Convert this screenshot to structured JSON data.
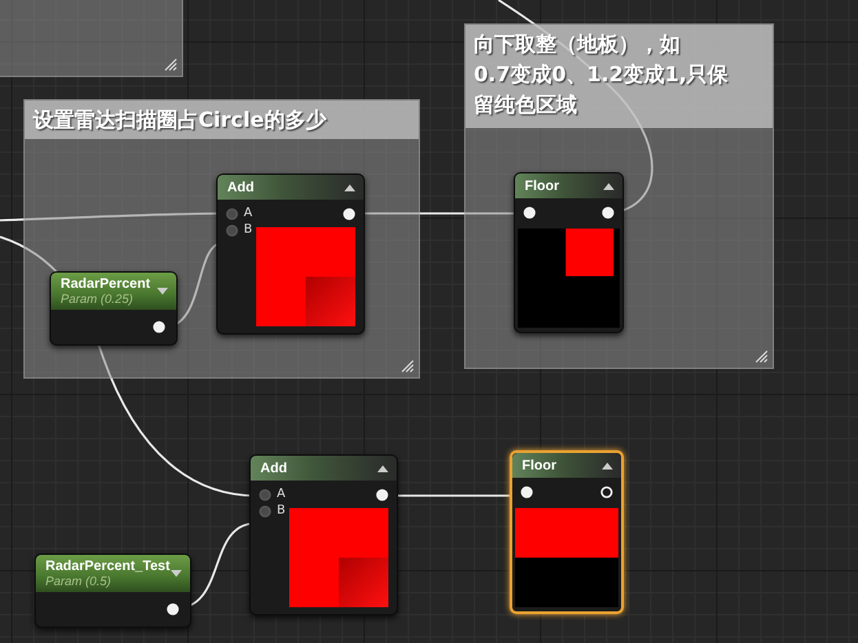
{
  "comments": [
    {
      "kind": "cut-off"
    },
    {
      "kind": "note",
      "text": "设置雷达扫描圈占Circle的多少"
    },
    {
      "kind": "note",
      "lines": [
        "向下取整（地板），如",
        "0.7变成0、1.2变成1,只保",
        "留纯色区域"
      ]
    }
  ],
  "nodes": [
    {
      "kind": "math",
      "title": "Add",
      "selected": false,
      "preview_expanded": true,
      "inputs": [
        {
          "label": "A",
          "connected": true
        },
        {
          "label": "B",
          "connected": true
        }
      ],
      "output": {
        "connected": true
      }
    },
    {
      "kind": "param",
      "title": "RadarPercent",
      "subtitle": "Param (0.25)",
      "selected": false,
      "preview_expanded": false,
      "output": {
        "connected": true
      }
    },
    {
      "kind": "math",
      "title": "Floor",
      "selected": false,
      "preview_expanded": true,
      "inputs": [
        {
          "connected": true
        }
      ],
      "output": {
        "connected": true
      }
    },
    {
      "kind": "math",
      "title": "Add",
      "selected": false,
      "preview_expanded": true,
      "inputs": [
        {
          "label": "A",
          "connected": true
        },
        {
          "label": "B",
          "connected": true
        }
      ],
      "output": {
        "connected": true
      }
    },
    {
      "kind": "param",
      "title": "RadarPercent_Test",
      "subtitle": "Param (0.5)",
      "selected": false,
      "preview_expanded": false,
      "output": {
        "connected": true
      }
    },
    {
      "kind": "math",
      "title": "Floor",
      "selected": true,
      "preview_expanded": true,
      "inputs": [
        {
          "connected": true
        }
      ],
      "output": {
        "connected": false
      }
    }
  ]
}
